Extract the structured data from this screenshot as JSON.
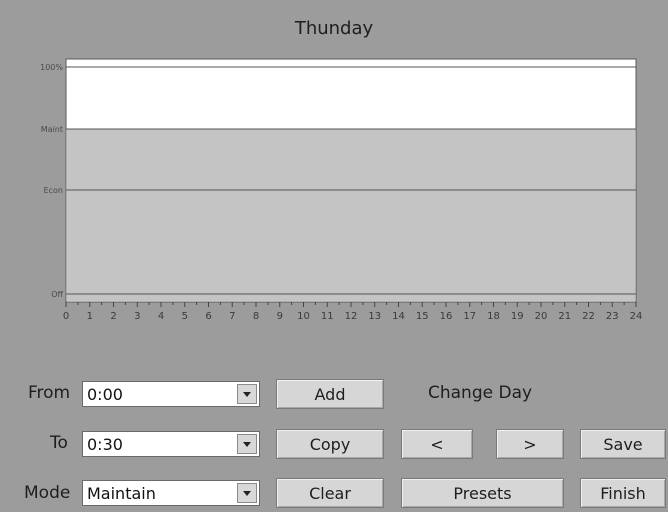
{
  "title": "Thunday",
  "chart_data": {
    "type": "area",
    "x_ticks": [
      "0",
      "1",
      "2",
      "3",
      "4",
      "5",
      "6",
      "7",
      "8",
      "9",
      "10",
      "11",
      "12",
      "13",
      "14",
      "15",
      "16",
      "17",
      "18",
      "19",
      "20",
      "21",
      "22",
      "23",
      "24"
    ],
    "y_levels": [
      "100%",
      "Maint",
      "Econ",
      "Off"
    ],
    "schedule_level": "Maint"
  },
  "controls": {
    "from_label": "From",
    "from_value": "0:00",
    "to_label": "To",
    "to_value": "0:30",
    "mode_label": "Mode",
    "mode_value": "Maintain",
    "change_day_label": "Change Day"
  },
  "buttons": {
    "add": "Add",
    "copy": "Copy",
    "clear": "Clear",
    "prev": "<",
    "next": ">",
    "presets": "Presets",
    "save": "Save",
    "finish": "Finish"
  }
}
